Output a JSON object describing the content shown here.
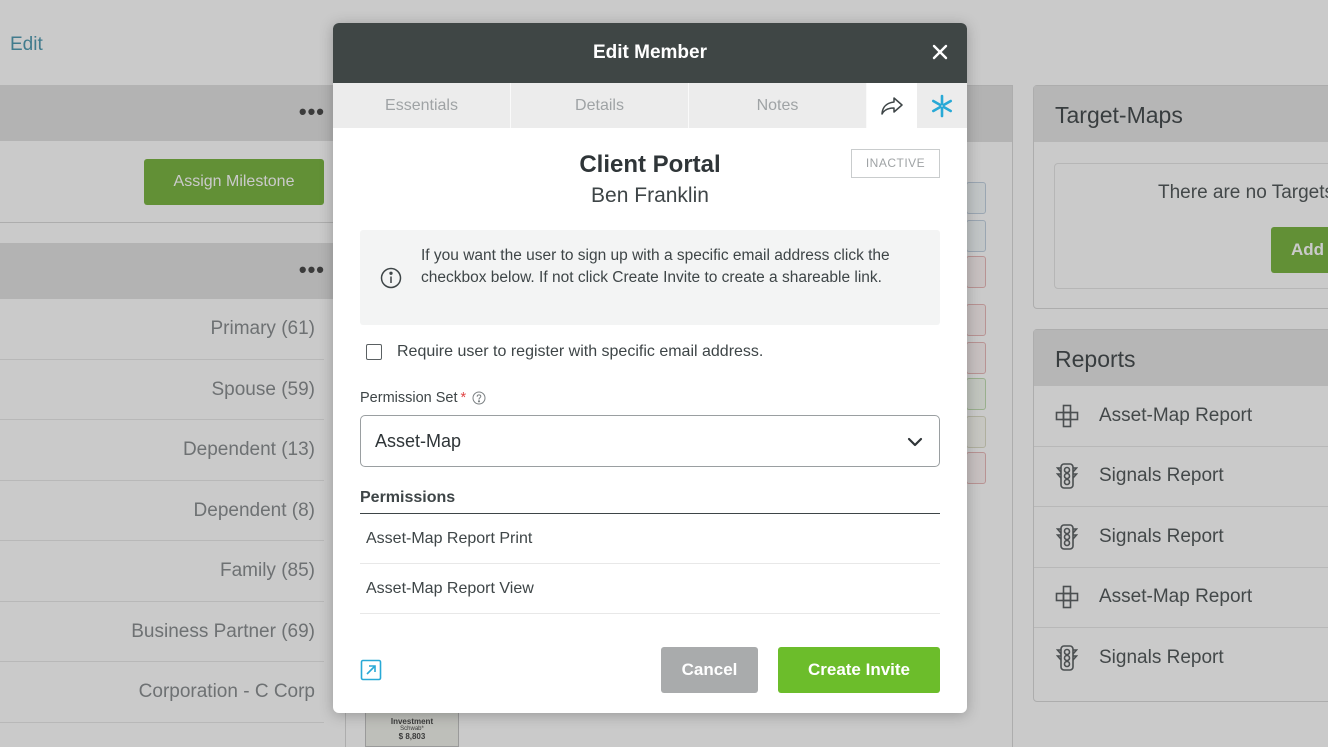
{
  "background": {
    "edit_link": "Edit",
    "assign_milestone": "Assign Milestone",
    "relationships": [
      "Primary (61)",
      "Spouse (59)",
      "Dependent (13)",
      "Dependent (8)",
      "Family (85)",
      "Business Partner (69)",
      "Corporation - C Corp"
    ],
    "target_maps": {
      "title": "Target-Maps",
      "empty_text": "There are no Targets",
      "add_label": "Add"
    },
    "reports": {
      "title": "Reports",
      "items": [
        {
          "label": "Asset-Map Report",
          "icon": "asset-map-icon"
        },
        {
          "label": "Signals Report",
          "icon": "traffic-light-icon"
        },
        {
          "label": "Signals Report",
          "icon": "traffic-light-icon"
        },
        {
          "label": "Asset-Map Report",
          "icon": "asset-map-icon"
        },
        {
          "label": "Signals Report",
          "icon": "traffic-light-icon"
        }
      ]
    },
    "investment_card": {
      "label": "Investment",
      "sub": "Schwab*",
      "value": "$ 8,803"
    }
  },
  "modal": {
    "title": "Edit Member",
    "tabs": [
      "Essentials",
      "Details",
      "Notes"
    ],
    "portal_title": "Client Portal",
    "member_name": "Ben Franklin",
    "status": "INACTIVE",
    "info_text": "If you want the user to sign up with a specific email address click the checkbox below. If not click Create Invite to create a shareable link.",
    "checkbox_label": "Require user to register with specific email address.",
    "checkbox_checked": false,
    "permission_set_label": "Permission Set",
    "permission_set_value": "Asset-Map",
    "permissions_heading": "Permissions",
    "permissions": [
      "Asset-Map Report Print",
      "Asset-Map Report View"
    ],
    "cancel_label": "Cancel",
    "create_invite_label": "Create Invite"
  },
  "colors": {
    "header": "#3f4645",
    "accent_green": "#6cbd2b",
    "accent_blue": "#28a9d6",
    "required": "#e04545"
  }
}
